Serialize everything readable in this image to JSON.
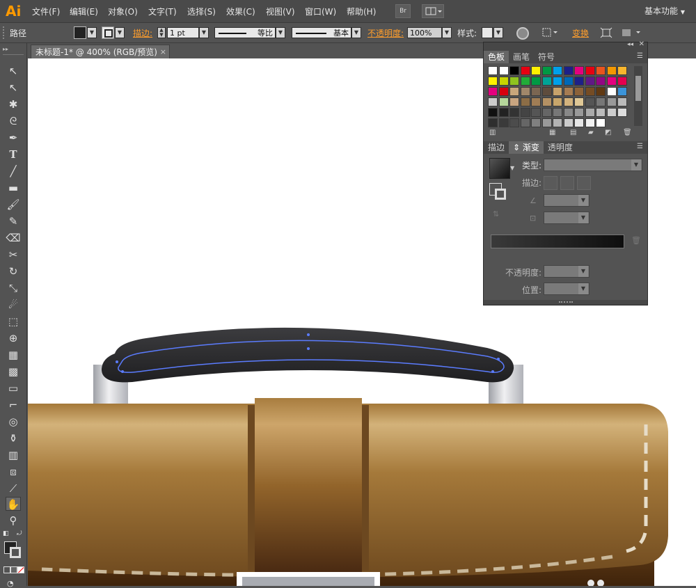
{
  "app": {
    "logo": "Ai",
    "workspace": "基本功能"
  },
  "menu": [
    "文件(F)",
    "编辑(E)",
    "对象(O)",
    "文字(T)",
    "选择(S)",
    "效果(C)",
    "视图(V)",
    "窗口(W)",
    "帮助(H)"
  ],
  "menubar_buttons": {
    "bridge": "Br"
  },
  "control": {
    "object_type": "路径",
    "stroke_label": "描边:",
    "stroke_weight": "1 pt",
    "profile": "等比",
    "brush": "基本",
    "opacity_label": "不透明度:",
    "opacity_value": "100%",
    "style_label": "样式:",
    "transform_label": "变换"
  },
  "document": {
    "tab_title": "未标题-1* @ 400% (RGB/预览)",
    "close": "×"
  },
  "swatch_panel": {
    "tabs": [
      "色板",
      "画笔",
      "符号"
    ],
    "active_tab": "色板",
    "rows": [
      [
        "#ffffff",
        "#ffffff",
        "#000000",
        "#e60012",
        "#fff100",
        "#009944",
        "#00a0e9",
        "#1d2088",
        "#e4007f",
        "#e60012",
        "#e9541e",
        "#f39800",
        "#f8b62d"
      ],
      [
        "#fff100",
        "#c9d400",
        "#8fc31f",
        "#22ac38",
        "#009944",
        "#00a496",
        "#00a0e9",
        "#0068b7",
        "#1d2088",
        "#601986",
        "#920783",
        "#e4007f",
        "#e5004f"
      ],
      [
        "#e4007f",
        "#d7000f",
        "#c9a67b",
        "#a0876a",
        "#7b6652",
        "#5e4c3d",
        "#c7a26b",
        "#a67c52",
        "#8c6239",
        "#754c24",
        "#603913",
        "#ffffff",
        "#3b94d9"
      ],
      [
        "#cccccc",
        "#b5d69b",
        "#c9a580",
        "#8c6d46",
        "#a07d55",
        "#b49164",
        "#c8a66b",
        "#d4b37d",
        "#e0c896",
        "#555555",
        "#777777",
        "#999999",
        "#bbbbbb"
      ],
      [
        "#111111",
        "#222222",
        "#333333",
        "#444444",
        "#555555",
        "#666666",
        "#777777",
        "#888888",
        "#999999",
        "#aaaaaa",
        "#bbbbbb",
        "#cccccc",
        "#dddddd"
      ],
      [
        "#2e2e2e",
        "#3a3a3a",
        "#4c4c4c",
        "#666666",
        "#808080",
        "#999999",
        "#b3b3b3",
        "#cccccc",
        "#e6e6e6",
        "#f2f2f2",
        "#ffffff"
      ]
    ]
  },
  "gradient_panel": {
    "tabs": [
      "描边",
      "渐变",
      "透明度"
    ],
    "active_tab": "渐变",
    "type_label": "类型:",
    "stroke_label": "描边:",
    "opacity_label": "不透明度:",
    "position_label": "位置:"
  },
  "colors": {
    "accent": "#ff9e2c",
    "ui_bg": "#535353",
    "handle": "#2b2b2d",
    "leather_light": "#c9a46a",
    "leather_dark": "#5a3516",
    "path_highlight": "#5b7cff"
  }
}
